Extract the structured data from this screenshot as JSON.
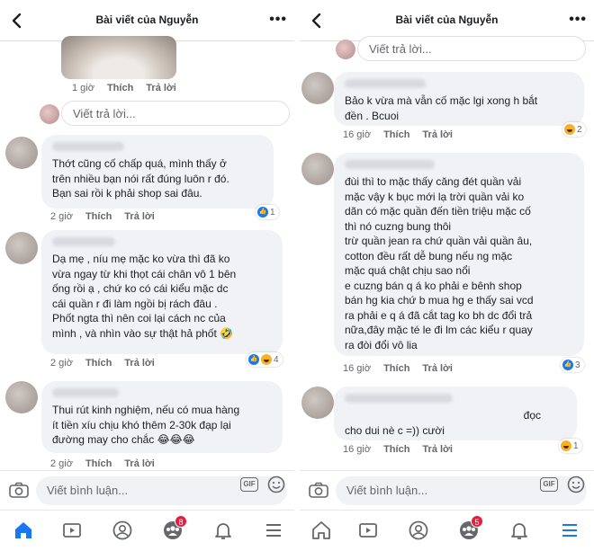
{
  "colors": {
    "accent": "#1877f2",
    "bubble": "#f0f2f5",
    "meta": "#65676b",
    "badge": "#e41e3f"
  },
  "left": {
    "header": {
      "title": "Bài viết của Nguyễn",
      "more": "•••"
    },
    "top_meta": {
      "time": "1 giờ",
      "like": "Thích",
      "reply": "Trả lời"
    },
    "reply_placeholder": "Viết trả lời...",
    "comments": [
      {
        "lines": [
          "Thớt cũng cố chấp quá, mình thấy ở",
          "trên nhiều bạn nói rất đúng luôn r đó.",
          "Bạn sai rồi k phải shop sai đâu."
        ],
        "time": "2 giờ",
        "like": "Thích",
        "reply": "Trả lời",
        "reaction_count": "1"
      },
      {
        "lines": [
          "Dạ mẹ , níu mẹ mặc ko vừa thì đã ko",
          "vừa ngay từ khi thọt cái chân vô 1 bên",
          "ống rồi ạ , chứ ko có cái kiểu mặc dc",
          "cái quần r đi làm ngồi bị rách đâu .",
          "Phốt ngta thì nên coi lại cách nc của",
          "mình , và nhìn vào sự thật hả phốt 🤣"
        ],
        "time": "2 giờ",
        "like": "Thích",
        "reply": "Trả lời",
        "reaction_count": "4"
      },
      {
        "lines": [
          "Thui rút kinh nghiệm, nếu có mua hàng",
          "ít tiền xíu chịu khó thêm 2-30k đạp lại",
          "đường may cho chắc 😂😂😂"
        ],
        "time": "2 giờ",
        "like": "Thích",
        "reply": "Trả lời"
      }
    ],
    "composer": {
      "placeholder": "Viết bình luận...",
      "gif": "GIF"
    },
    "nav": {
      "badge": "8"
    }
  },
  "right": {
    "header": {
      "title": "Bài viết của Nguyễn",
      "more": "•••"
    },
    "reply_placeholder": "Viết trả lời...",
    "comments": [
      {
        "lines": [
          "Bảo k vừa mà vẫn cố mặc lgi xong h bắt",
          "đền . Bcuoi"
        ],
        "time": "16 giờ",
        "like": "Thích",
        "reply": "Trả lời",
        "reaction_count": "2"
      },
      {
        "lines": [
          "đùi thì to mặc thấy căng đét quần vải",
          "mặc vậy k bục mới lạ trời quần vải ko",
          "dãn có mặc quần đến tiền triệu mặc cố",
          "thì nó cuzng bung thôi",
          "trừ quần jean ra chứ quần vải quần âu,",
          "cotton đều rất dễ bung nếu ng mặc",
          "mặc quá chật chịu sao nổi",
          "e cuzng bán q á ko phải e bênh shop",
          "bán hg kia chứ b mua hg e thấy sai vcd",
          "ra phải e q á đã cắt tag ko bh dc đổi trả",
          "nữa,đây mặc té le đi lm các kiểu r quay",
          "ra đòi đổi vô lia"
        ],
        "time": "16 giờ",
        "like": "Thích",
        "reply": "Trả lời",
        "reaction_count": "3"
      },
      {
        "lines": [
          "đọc",
          "cho dui nè c =)) cười"
        ],
        "time": "16 giờ",
        "like": "Thích",
        "reply": "Trả lời",
        "reaction_count": "1"
      }
    ],
    "composer": {
      "placeholder": "Viết bình luận...",
      "gif": "GIF"
    },
    "nav": {
      "badge": "5"
    }
  }
}
